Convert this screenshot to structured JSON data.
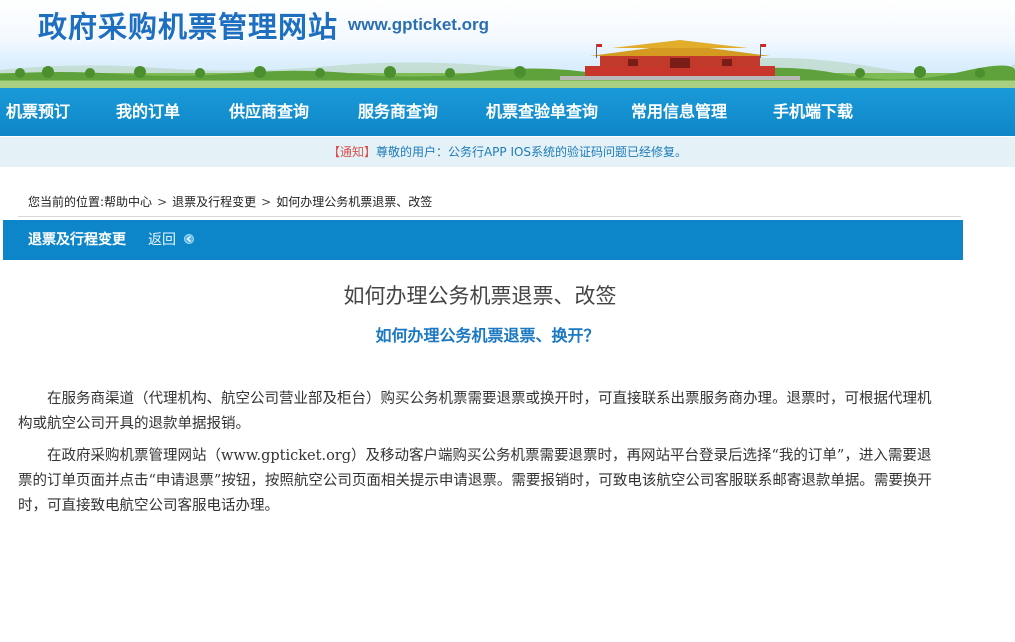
{
  "header": {
    "site_title": "政府采购机票管理网站",
    "site_url": "www.gpticket.org"
  },
  "nav": {
    "items": [
      {
        "label": "机票预订"
      },
      {
        "label": "我的订单"
      },
      {
        "label": "供应商查询"
      },
      {
        "label": "服务商查询"
      },
      {
        "label": "机票查验单查询"
      },
      {
        "label": "常用信息管理"
      },
      {
        "label": "手机端下载"
      }
    ]
  },
  "notice": {
    "tag": "【通知】",
    "text": "尊敬的用户：公务行APP IOS系统的验证码问题已经修复。"
  },
  "breadcrumb": {
    "prefix": "您当前的位置:",
    "items": [
      "帮助中心",
      "退票及行程变更",
      "如何办理公务机票退票、改签"
    ],
    "separator": ">"
  },
  "section": {
    "title": "退票及行程变更",
    "back_label": "返回"
  },
  "article": {
    "title": "如何办理公务机票退票、改签",
    "subtitle": "如何办理公务机票退票、换开？",
    "paragraphs": [
      "在服务商渠道（代理机构、航空公司营业部及柜台）购买公务机票需要退票或换开时，可直接联系出票服务商办理。退票时，可根据代理机构或航空公司开具的退款单据报销。",
      "在政府采购机票管理网站（www.gpticket.org）及移动客户端购买公务机票需要退票时，再网站平台登录后选择“我的订单”，进入需要退票的订单页面并点击“申请退票”按钮，按照航空公司页面相关提示申请退票。需要报销时，可致电该航空公司客服联系邮寄退款单据。需要换开时，可直接致电航空公司客服电话办理。"
    ]
  },
  "colors": {
    "nav_bg": "#0e86c8",
    "section_bar_bg": "#0d86c9",
    "notice_bg": "#e4f2f8",
    "title_blue": "#1f6fc0",
    "subtitle_blue": "#1b78c2",
    "notice_red": "#d9534f"
  }
}
